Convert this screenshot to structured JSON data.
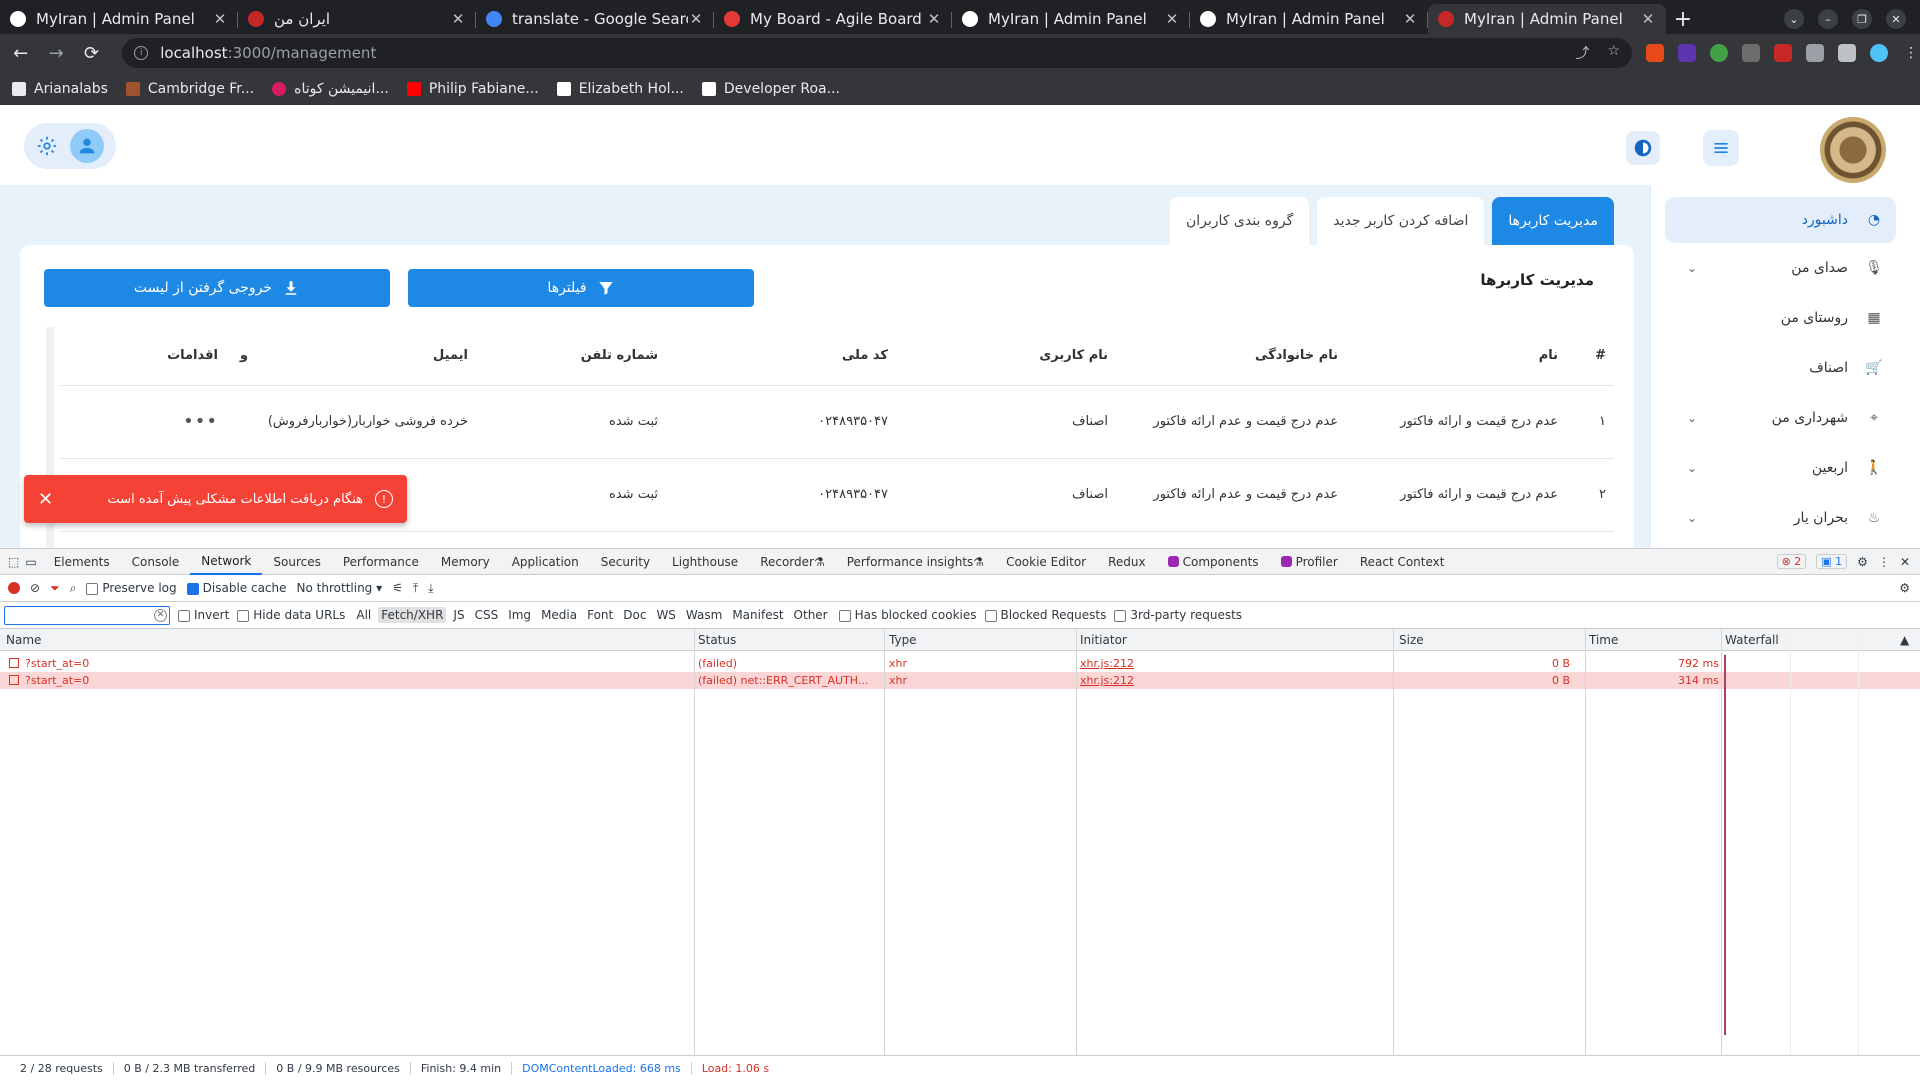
{
  "browser": {
    "tabs": [
      {
        "title": "MyIran | Admin Panel",
        "favicon_color": "#ffffff"
      },
      {
        "title": "ایران من",
        "favicon_color": "#c62828"
      },
      {
        "title": "translate - Google Search",
        "favicon_color": "#4285f4"
      },
      {
        "title": "My Board - Agile Board - A",
        "favicon_color": "#e53935"
      },
      {
        "title": "MyIran | Admin Panel",
        "favicon_color": "#ffffff"
      },
      {
        "title": "MyIran | Admin Panel",
        "favicon_color": "#ffffff"
      },
      {
        "title": "MyIran | Admin Panel",
        "favicon_color": "#c62828"
      }
    ],
    "url_host": "localhost",
    "url_path": ":3000/management",
    "bookmarks": [
      "Arianalabs",
      "Cambridge Fr...",
      "انیمیشن کوتاه...",
      "Philip Fabiane...",
      "Elizabeth Hol...",
      "Developer Roa..."
    ]
  },
  "app": {
    "tabs": [
      "مدیریت کاربرها",
      "اضافه کردن کاربر جدید",
      "گروه بندی کاربران"
    ],
    "card_title": "مدیریت کاربرها",
    "filter_button": "فیلترها",
    "export_button": "خروجی گرفتن از لیست",
    "table": {
      "headers": [
        "#",
        "نام",
        "نام خانوادگی",
        "نام کاربری",
        "کد ملی",
        "شماره تلفن",
        "ایمیل",
        "و",
        "اقدامات"
      ],
      "rows": [
        [
          "۱",
          "عدم درج قیمت و ارائه فاکتور",
          "عدم درج قیمت و عدم ارائه فاکتور",
          "اصناف",
          "۰۲۴۸۹۳۵۰۴۷",
          "ثبت شده",
          "خرده فروشی خواربار(خواربارفروش)"
        ],
        [
          "۲",
          "عدم درج قیمت و ارائه فاکتور",
          "عدم درج قیمت و عدم ارائه فاکتور",
          "اصناف",
          "۰۲۴۸۹۳۵۰۴۷",
          "ثبت شده",
          ""
        ]
      ],
      "actions_label": "•••"
    },
    "sidebar": [
      {
        "label": "داشبورد",
        "icon": "dashboard-icon",
        "active": true,
        "expandable": false
      },
      {
        "label": "صدای من",
        "icon": "microphone-icon",
        "active": false,
        "expandable": true
      },
      {
        "label": "روستای من",
        "icon": "map-icon",
        "active": false,
        "expandable": false
      },
      {
        "label": "اصناف",
        "icon": "cart-icon",
        "active": false,
        "expandable": false
      },
      {
        "label": "شهرداری من",
        "icon": "route-icon",
        "active": false,
        "expandable": true
      },
      {
        "label": "اربعین",
        "icon": "walking-icon",
        "active": false,
        "expandable": true
      },
      {
        "label": "بحران یار",
        "icon": "fire-icon",
        "active": false,
        "expandable": true
      }
    ],
    "toast": {
      "message": "هنگام دریافت اطلاعات مشکلی پیش آمده است",
      "color": "#f44336"
    },
    "accent_color": "#1e88e5"
  },
  "devtools": {
    "tabs": [
      "Elements",
      "Console",
      "Network",
      "Sources",
      "Performance",
      "Memory",
      "Application",
      "Security",
      "Lighthouse",
      "Recorder",
      "Performance insights",
      "Cookie Editor",
      "Redux",
      "Components",
      "Profiler",
      "React Context"
    ],
    "active_tab": "Network",
    "error_count": "2",
    "message_count": "1",
    "toolbar": {
      "preserve_log": "Preserve log",
      "disable_cache": "Disable cache",
      "throttling": "No throttling"
    },
    "filter": {
      "invert": "Invert",
      "hide_data_urls": "Hide data URLs",
      "types": [
        "All",
        "Fetch/XHR",
        "JS",
        "CSS",
        "Img",
        "Media",
        "Font",
        "Doc",
        "WS",
        "Wasm",
        "Manifest",
        "Other"
      ],
      "selected_type": "Fetch/XHR",
      "has_blocked_cookies": "Has blocked cookies",
      "blocked_requests": "Blocked Requests",
      "third_party": "3rd-party requests"
    },
    "columns": [
      "Name",
      "Status",
      "Type",
      "Initiator",
      "Size",
      "Time",
      "Waterfall"
    ],
    "requests": [
      {
        "name": "?start_at=0",
        "status": "(failed)",
        "type": "xhr",
        "initiator": "xhr.js:212",
        "size": "0 B",
        "time": "792 ms"
      },
      {
        "name": "?start_at=0",
        "status": "(failed) net::ERR_CERT_AUTH...",
        "type": "xhr",
        "initiator": "xhr.js:212",
        "size": "0 B",
        "time": "314 ms"
      }
    ],
    "status_bar": {
      "requests": "2 / 28 requests",
      "transferred": "0 B / 2.3 MB transferred",
      "resources": "0 B / 9.9 MB resources",
      "finish": "Finish: 9.4 min",
      "dom_content_loaded": "DOMContentLoaded: 668 ms",
      "load": "Load: 1.06 s"
    }
  }
}
